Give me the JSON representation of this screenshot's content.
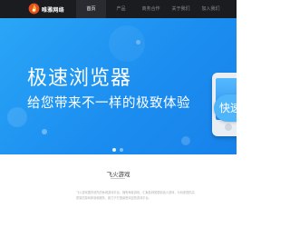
{
  "header": {
    "logo_text": "唯雅网络",
    "nav": [
      {
        "label": "首页",
        "active": true
      },
      {
        "label": "产品",
        "active": false
      },
      {
        "label": "商务合作",
        "active": false
      },
      {
        "label": "关于我们",
        "active": false
      },
      {
        "label": "加入我们",
        "active": false
      }
    ]
  },
  "hero": {
    "title": "极速浏览器",
    "subtitle": "给您带来不一样的极致体验",
    "badge": "快速",
    "slides": 2,
    "active_slide": 0
  },
  "section": {
    "title": "飞火游戏",
    "description": "飞火游戏国内领先的休闲游戏平台，拥有海量游戏，汇聚各种类型精品小游戏，为玩家提供高质量的游戏体验和服务，致力于打造最受欢迎的游戏平台。"
  },
  "colors": {
    "nav_bg": "#1b1c20",
    "hero_blue": "#1c8ef0",
    "text_muted": "#b0b0b0"
  },
  "icons": {
    "logo": "flame-logo-icon"
  }
}
